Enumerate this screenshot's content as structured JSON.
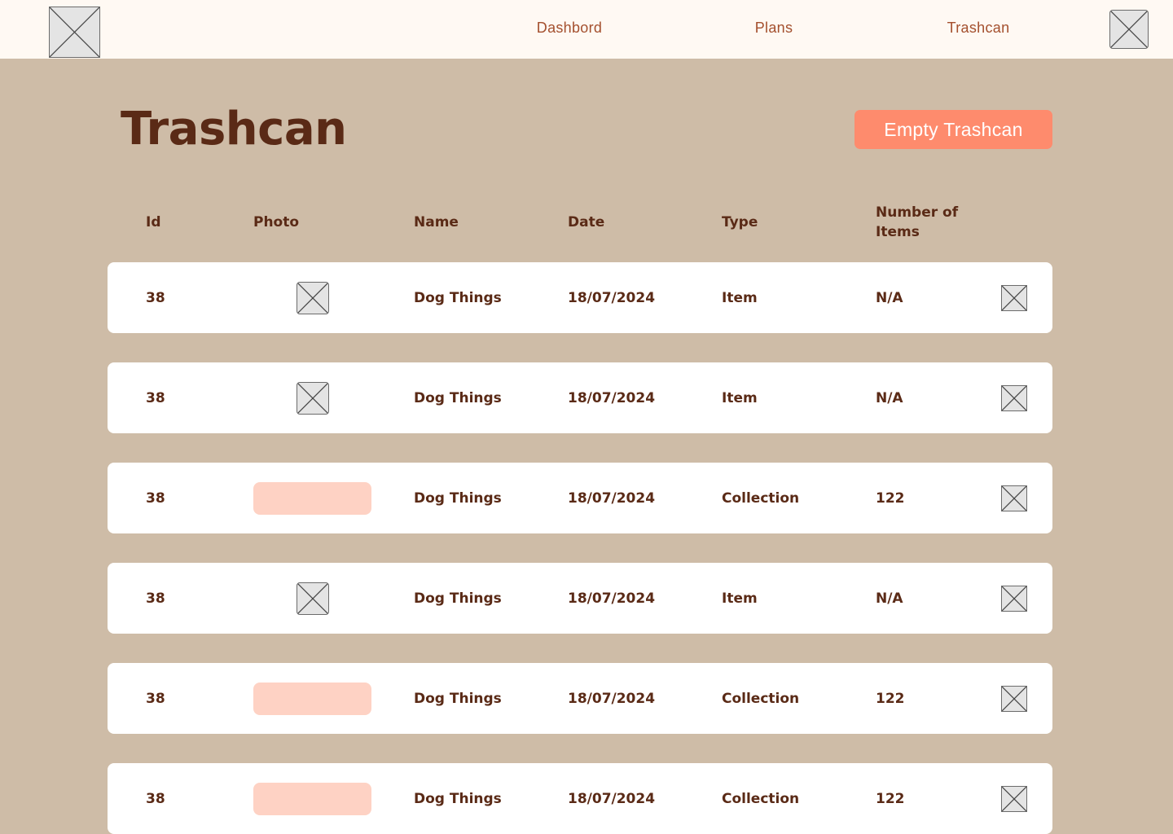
{
  "nav": {
    "logo_icon": "image-placeholder-icon",
    "links": [
      "Dashbord",
      "Plans",
      "Trashcan"
    ],
    "profile_icon": "image-placeholder-icon"
  },
  "page": {
    "title": "Trashcan",
    "empty_button_label": "Empty Trashcan"
  },
  "colors": {
    "background": "#cebca7",
    "topbar": "#fff9f3",
    "accent": "#fe8b6d",
    "swatch": "#fed2c4",
    "text": "#5a2a16",
    "nav_text": "#a4502e"
  },
  "table": {
    "headers": [
      "Id",
      "Photo",
      "Name",
      "Date",
      "Type",
      "Number of Items"
    ],
    "rows": [
      {
        "id": "38",
        "photo": "image-placeholder-icon",
        "name": "Dog Things",
        "date": "18/07/2024",
        "type": "Item",
        "count": "N/A",
        "action_icon": "image-placeholder-icon"
      },
      {
        "id": "38",
        "photo": "image-placeholder-icon",
        "name": "Dog Things",
        "date": "18/07/2024",
        "type": "Item",
        "count": "N/A",
        "action_icon": "image-placeholder-icon"
      },
      {
        "id": "38",
        "photo": "collection-swatch",
        "name": "Dog Things",
        "date": "18/07/2024",
        "type": "Collection",
        "count": "122",
        "action_icon": "image-placeholder-icon"
      },
      {
        "id": "38",
        "photo": "image-placeholder-icon",
        "name": "Dog Things",
        "date": "18/07/2024",
        "type": "Item",
        "count": "N/A",
        "action_icon": "image-placeholder-icon"
      },
      {
        "id": "38",
        "photo": "collection-swatch",
        "name": "Dog Things",
        "date": "18/07/2024",
        "type": "Collection",
        "count": "122",
        "action_icon": "image-placeholder-icon"
      },
      {
        "id": "38",
        "photo": "collection-swatch",
        "name": "Dog Things",
        "date": "18/07/2024",
        "type": "Collection",
        "count": "122",
        "action_icon": "image-placeholder-icon"
      }
    ]
  }
}
